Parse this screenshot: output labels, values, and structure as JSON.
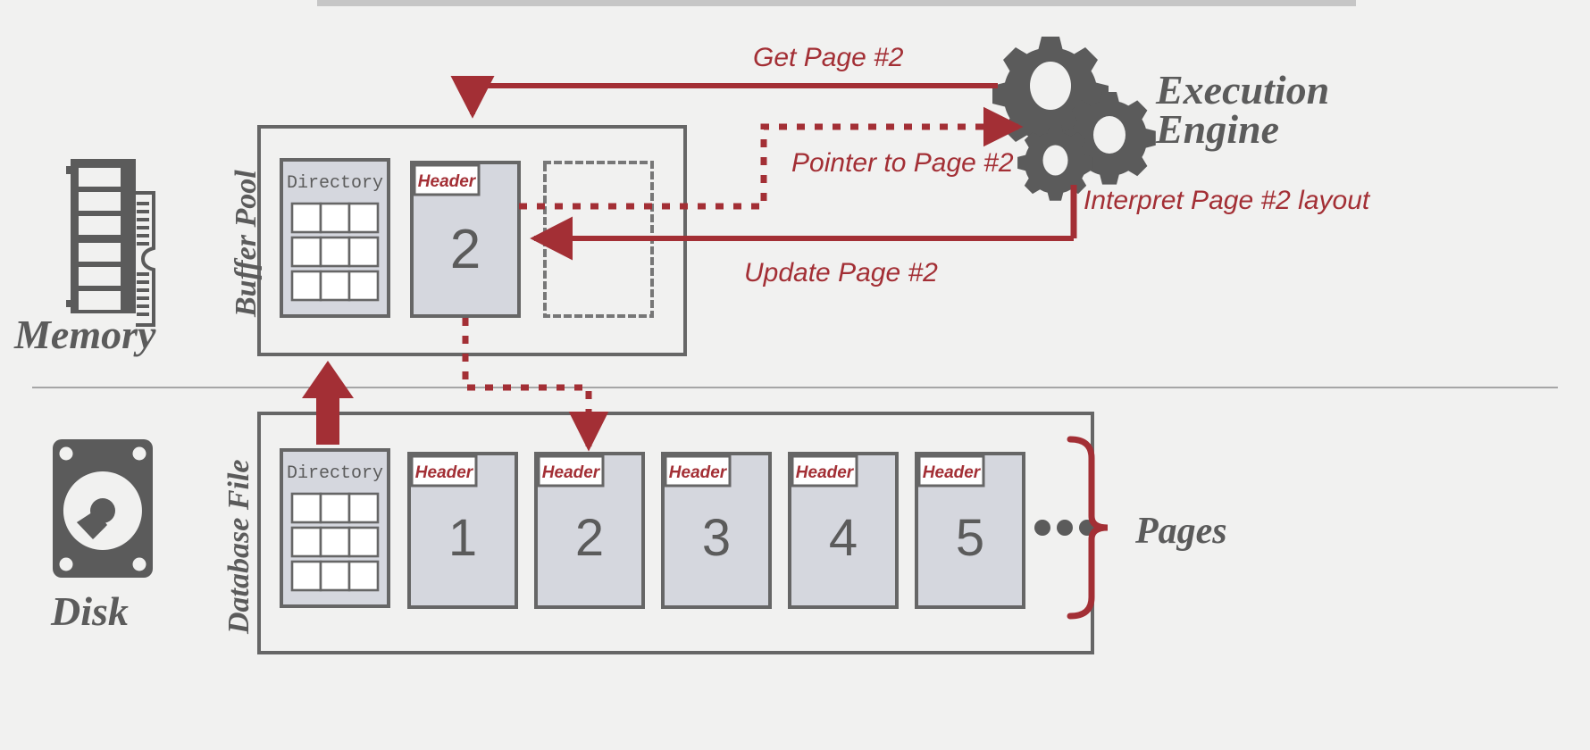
{
  "diagram": {
    "title_region": "database buffer pool and page layout diagram",
    "top_bar_color": "#c6c6c6",
    "background_color": "#f1f1f0",
    "divider_color": "#8d8d8d",
    "gray_ink": "#5b5b5b",
    "page_fill": "#d5d7de",
    "page_stroke": "#666666",
    "accent_red": "#a32f35"
  },
  "labels": {
    "memory": "Memory",
    "disk": "Disk",
    "buffer_pool": "Buffer Pool",
    "database_file": "Database File",
    "execution_engine_line1": "Execution",
    "execution_engine_line2": "Engine",
    "pages_brace": "Pages",
    "ellipsis": "•••"
  },
  "arrows": [
    {
      "id": "get-page",
      "label": "Get Page #2",
      "style": "solid"
    },
    {
      "id": "pointer-to-page",
      "label": "Pointer to Page #2",
      "style": "dotted"
    },
    {
      "id": "interpret-page",
      "label": "Interpret Page #2 layout",
      "style": "solid"
    },
    {
      "id": "update-page",
      "label": "Update Page #2",
      "style": "solid"
    },
    {
      "id": "fetch-from-disk",
      "label": "",
      "style": "dotted"
    },
    {
      "id": "load-into-memory",
      "label": "",
      "style": "block"
    }
  ],
  "buffer_pool": {
    "directory_label": "Directory",
    "directory_rows": 3,
    "directory_cols": 3,
    "frames": [
      {
        "kind": "page",
        "header": "Header",
        "number": "2"
      },
      {
        "kind": "empty",
        "header": "",
        "number": ""
      }
    ]
  },
  "database_file": {
    "directory_label": "Directory",
    "directory_rows": 3,
    "directory_cols": 3,
    "pages": [
      {
        "header": "Header",
        "number": "1"
      },
      {
        "header": "Header",
        "number": "2"
      },
      {
        "header": "Header",
        "number": "3"
      },
      {
        "header": "Header",
        "number": "4"
      },
      {
        "header": "Header",
        "number": "5"
      }
    ]
  },
  "icons": {
    "memory_icon": "ram-module-icon",
    "disk_icon": "hard-disk-icon",
    "engine_icon": "gears-icon"
  }
}
